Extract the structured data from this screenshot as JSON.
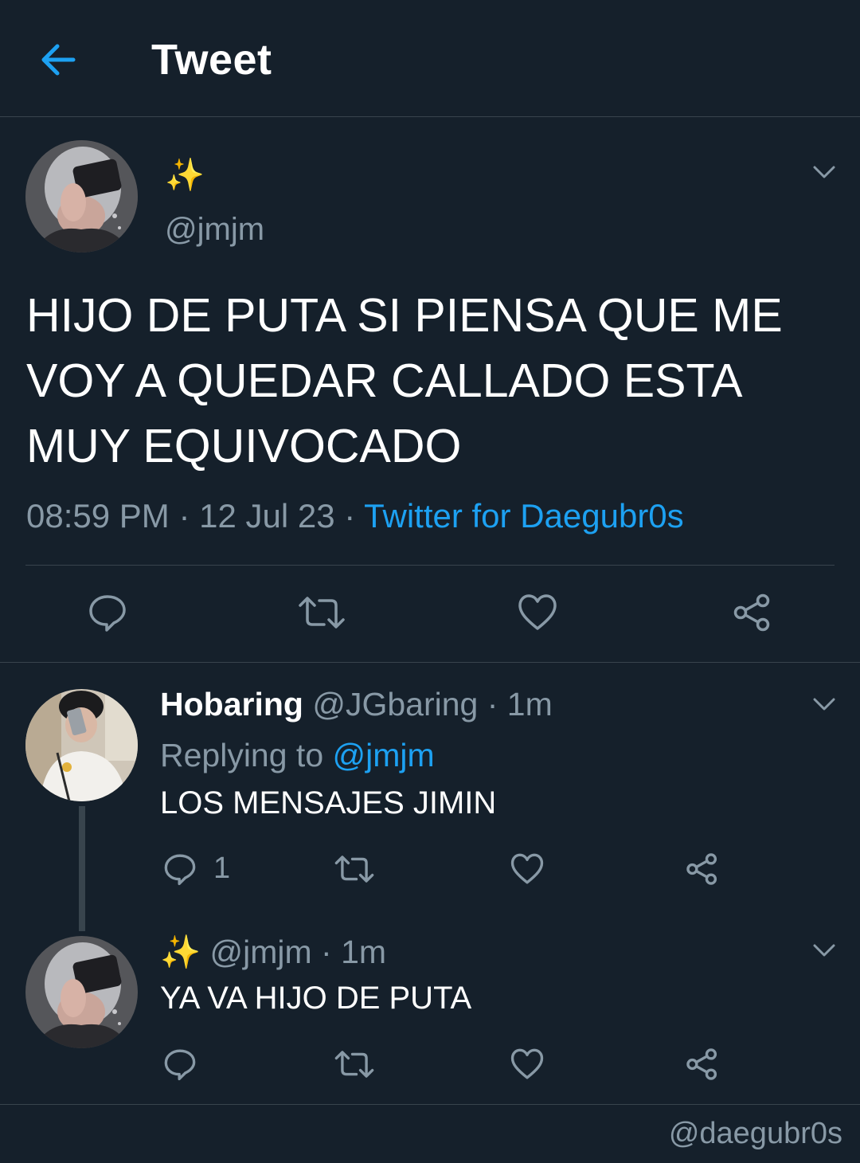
{
  "header": {
    "title": "Tweet",
    "back_icon": "arrow-left-icon",
    "accent_color": "#1da1f2"
  },
  "main_tweet": {
    "display_name": "✨",
    "handle": "@jmjm",
    "text": "HIJO DE PUTA SI PIENSA QUE ME VOY A QUEDAR CALLADO ESTA MUY EQUIVOCADO",
    "time": "08:59 PM",
    "date": "12 Jul 23",
    "separator": " · ",
    "source": "Twitter for Daegubr0s",
    "actions": [
      "reply-icon",
      "retweet-icon",
      "like-icon",
      "share-icon"
    ]
  },
  "replies": [
    {
      "display_name": "Hobaring",
      "handle": "@JGbaring",
      "time_sep": " · ",
      "time": "1m",
      "replying_label": "Replying to ",
      "replying_to": "@jmjm",
      "text": "LOS MENSAJES JIMIN",
      "reply_count": "1"
    },
    {
      "display_name": "✨",
      "handle": "@jmjm",
      "time_sep": " · ",
      "time": "1m",
      "text": "YA VA HIJO DE PUTA"
    }
  ],
  "watermark": "@daegubr0s",
  "colors": {
    "background": "#15202b",
    "muted": "#8899a6",
    "divider": "#38444d",
    "link": "#1da1f2"
  }
}
